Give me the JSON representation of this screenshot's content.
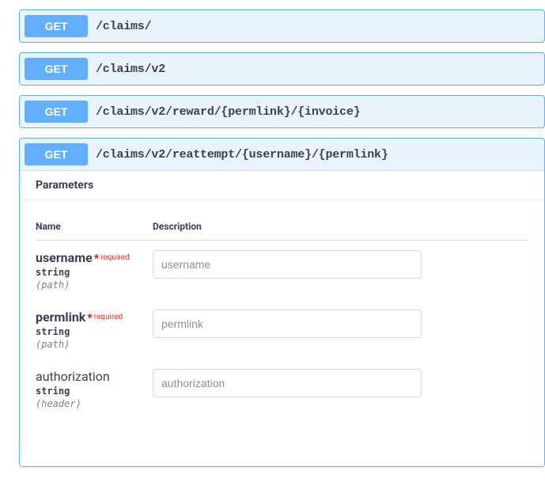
{
  "colors": {
    "method_get": "#61affe",
    "required": "#ff2b2b"
  },
  "endpoints": [
    {
      "method": "GET",
      "path": "/claims/"
    },
    {
      "method": "GET",
      "path": "/claims/v2"
    },
    {
      "method": "GET",
      "path": "/claims/v2/reward/{permlink}/{invoice}"
    },
    {
      "method": "GET",
      "path": "/claims/v2/reattempt/{username}/{permlink}"
    }
  ],
  "expanded": {
    "section_title": "Parameters",
    "table_headers": {
      "name": "Name",
      "description": "Description"
    },
    "required_label": "required",
    "params": [
      {
        "name": "username",
        "required": true,
        "type": "string",
        "in": "(path)",
        "placeholder": "username"
      },
      {
        "name": "permlink",
        "required": true,
        "type": "string",
        "in": "(path)",
        "placeholder": "permlink"
      },
      {
        "name": "authorization",
        "required": false,
        "type": "string",
        "in": "(header)",
        "placeholder": "authorization"
      }
    ]
  }
}
